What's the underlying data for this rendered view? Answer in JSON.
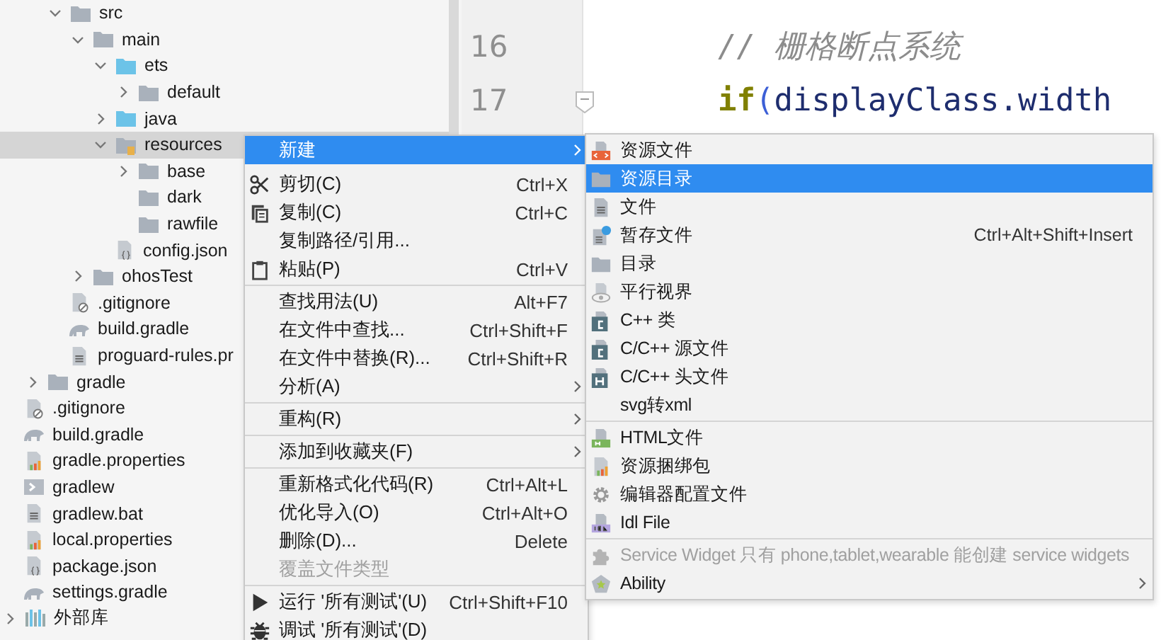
{
  "project_tree": {
    "cut_branch": [
      {
        "label": "src",
        "kind": "folder",
        "expanded": true,
        "selected": false,
        "children": [
          {
            "label": "main",
            "kind": "folder",
            "expanded": true,
            "selected": false,
            "children": [
              {
                "label": "ets",
                "kind": "source-folder",
                "expanded": true,
                "selected": false,
                "children": [
                  {
                    "label": "default",
                    "kind": "folder",
                    "expanded": false,
                    "selected": false
                  }
                ]
              },
              {
                "label": "java",
                "kind": "source-folder",
                "expanded": false,
                "selected": false
              },
              {
                "label": "resources",
                "kind": "resource-folder",
                "expanded": true,
                "selected": true,
                "children": [
                  {
                    "label": "base",
                    "kind": "folder",
                    "expanded": false,
                    "selected": false
                  },
                  {
                    "label": "dark",
                    "kind": "folder",
                    "selected": false
                  },
                  {
                    "label": "rawfile",
                    "kind": "folder",
                    "selected": false
                  },
                  {
                    "label": "config.json",
                    "kind": "json-file",
                    "selected": false
                  }
                ]
              }
            ]
          },
          {
            "label": "ohosTest",
            "kind": "folder",
            "expanded": false,
            "selected": false
          },
          {
            "label": ".gitignore",
            "kind": "ignore-file",
            "selected": false
          },
          {
            "label": "build.gradle",
            "kind": "gradle-file",
            "selected": false
          },
          {
            "label": "proguard-rules.pr",
            "kind": "text-file",
            "selected": false
          }
        ]
      }
    ],
    "items": [
      {
        "label": "gradle",
        "kind": "folder",
        "expanded": false,
        "selected": false
      },
      {
        "label": ".gitignore",
        "kind": "ignore-file",
        "selected": false
      },
      {
        "label": "build.gradle",
        "kind": "gradle-file",
        "selected": false
      },
      {
        "label": "gradle.properties",
        "kind": "properties-file",
        "selected": false
      },
      {
        "label": "gradlew",
        "kind": "script-file",
        "selected": false
      },
      {
        "label": "gradlew.bat",
        "kind": "text-file",
        "selected": false
      },
      {
        "label": "local.properties",
        "kind": "properties-file",
        "selected": false
      },
      {
        "label": "package.json",
        "kind": "json-file",
        "selected": false
      },
      {
        "label": "settings.gradle",
        "kind": "gradle-file",
        "selected": false
      }
    ],
    "root_items": [
      {
        "label": "外部库",
        "kind": "library",
        "expanded": false,
        "selected": false
      }
    ]
  },
  "editor": {
    "line_numbers": [
      "16",
      "17"
    ],
    "lines": [
      {
        "kind": "comment",
        "tokens": [
          {
            "kind": "comment",
            "text": "// 栅格断点系统"
          }
        ]
      },
      {
        "kind": "code",
        "tokens": [
          {
            "kind": "keyword",
            "text": "if"
          },
          {
            "kind": "paren",
            "text": "("
          },
          {
            "kind": "ident",
            "text": "displayClass"
          },
          {
            "kind": "dot",
            "text": "."
          },
          {
            "kind": "ident",
            "text": "width"
          }
        ]
      }
    ]
  },
  "context_menu": [
    {
      "label": "新建",
      "submenu": true,
      "selected": true,
      "disabled": false
    },
    {
      "label": "剪切(C)",
      "kind": "scissors",
      "shortcut": "Ctrl+X",
      "selected": false,
      "disabled": false
    },
    {
      "label": "复制(C)",
      "kind": "copy",
      "shortcut": "Ctrl+C",
      "selected": false,
      "disabled": false
    },
    {
      "label": "复制路径/引用...",
      "selected": false,
      "disabled": false
    },
    {
      "label": "粘贴(P)",
      "kind": "clipboard",
      "shortcut": "Ctrl+V",
      "separator_after": true,
      "selected": false,
      "disabled": false
    },
    {
      "label": "查找用法(U)",
      "shortcut": "Alt+F7",
      "selected": false,
      "disabled": false
    },
    {
      "label": "在文件中查找...",
      "shortcut": "Ctrl+Shift+F",
      "selected": false,
      "disabled": false
    },
    {
      "label": "在文件中替换(R)...",
      "shortcut": "Ctrl+Shift+R",
      "selected": false,
      "disabled": false
    },
    {
      "label": "分析(A)",
      "submenu": true,
      "separator_after": true,
      "selected": false,
      "disabled": false
    },
    {
      "label": "重构(R)",
      "submenu": true,
      "separator_after": true,
      "selected": false,
      "disabled": false
    },
    {
      "label": "添加到收藏夹(F)",
      "submenu": true,
      "separator_after": true,
      "selected": false,
      "disabled": false
    },
    {
      "label": "重新格式化代码(R)",
      "shortcut": "Ctrl+Alt+L",
      "selected": false,
      "disabled": false
    },
    {
      "label": "优化导入(O)",
      "shortcut": "Ctrl+Alt+O",
      "selected": false,
      "disabled": false
    },
    {
      "label": "删除(D)...",
      "shortcut": "Delete",
      "selected": false,
      "disabled": false
    },
    {
      "label": "覆盖文件类型",
      "separator_after": true,
      "selected": false,
      "disabled": true
    },
    {
      "label": "运行 '所有测试'(U)",
      "kind": "play",
      "shortcut": "Ctrl+Shift+F10",
      "selected": false,
      "disabled": false
    },
    {
      "label": "调试 '所有测试'(D)",
      "kind": "bug",
      "selected": false,
      "disabled": false
    }
  ],
  "new_submenu": [
    {
      "label": "资源文件",
      "kind": "resource-file",
      "selected": false,
      "disabled": false
    },
    {
      "label": "资源目录",
      "kind": "folder",
      "selected": true,
      "disabled": false
    },
    {
      "label": "文件",
      "kind": "file",
      "selected": false,
      "disabled": false
    },
    {
      "label": "暂存文件",
      "kind": "scratch-file",
      "shortcut": "Ctrl+Alt+Shift+Insert",
      "selected": false,
      "disabled": false
    },
    {
      "label": "目录",
      "kind": "folder",
      "selected": false,
      "disabled": false
    },
    {
      "label": "平行视界",
      "kind": "eye-file",
      "selected": false,
      "disabled": false
    },
    {
      "label": "C++ 类",
      "kind": "cpp-class",
      "selected": false,
      "disabled": false
    },
    {
      "label": "C/C++ 源文件",
      "kind": "c-source",
      "selected": false,
      "disabled": false
    },
    {
      "label": "C/C++ 头文件",
      "kind": "c-header",
      "selected": false,
      "disabled": false
    },
    {
      "label": "svg转xml",
      "separator_after": true,
      "selected": false,
      "disabled": false
    },
    {
      "label": "HTML文件",
      "kind": "html-file",
      "selected": false,
      "disabled": false
    },
    {
      "label": "资源捆绑包",
      "kind": "properties-file",
      "selected": false,
      "disabled": false
    },
    {
      "label": "编辑器配置文件",
      "kind": "gear",
      "selected": false,
      "disabled": false
    },
    {
      "label": "Idl File",
      "kind": "idl-file",
      "separator_after": true,
      "selected": false,
      "disabled": false
    },
    {
      "label": "Service Widget 只有 phone,tablet,wearable 能创建 service widgets",
      "kind": "puzzle",
      "selected": false,
      "disabled": true
    },
    {
      "label": "Ability",
      "kind": "ability",
      "submenu": true,
      "selected": false,
      "disabled": false
    }
  ]
}
